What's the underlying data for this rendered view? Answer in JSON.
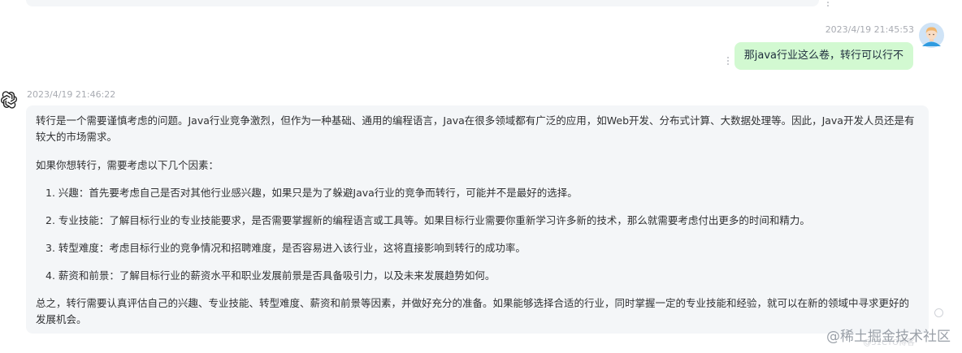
{
  "user_message": {
    "timestamp": "2023/4/19 21:45:53",
    "text": "那java行业这么卷，转行可以行不",
    "avatar_icon": "user-avatar-icon"
  },
  "assistant_message": {
    "timestamp": "2023/4/19 21:46:22",
    "avatar_icon": "openai-logo-icon",
    "intro": "转行是一个需要谨慎考虑的问题。Java行业竞争激烈，但作为一种基础、通用的编程语言，Java在很多领域都有广泛的应用，如Web开发、分布式计算、大数据处理等。因此，Java开发人员还是有较大的市场需求。",
    "lead": "如果你想转行，需要考虑以下几个因素：",
    "items": [
      "1. 兴趣：首先要考虑自己是否对其他行业感兴趣，如果只是为了躲避Java行业的竞争而转行，可能并不是最好的选择。",
      "2. 专业技能：了解目标行业的专业技能要求，是否需要掌握新的编程语言或工具等。如果目标行业需要你重新学习许多新的技术，那么就需要考虑付出更多的时间和精力。",
      "3. 转型难度：考虑目标行业的竞争情况和招聘难度，是否容易进入该行业，这将直接影响到转行的成功率。",
      "4. 薪资和前景：了解目标行业的薪资水平和职业发展前景是否具备吸引力，以及未来发展趋势如何。"
    ],
    "conclusion": "总之，转行需要认真评估自己的兴趣、专业技能、转型难度、薪资和前景等因素，并做好充分的准备。如果能够选择合适的行业，同时掌握一定的专业技能和经验，就可以在新的领域中寻求更好的发展机会。"
  },
  "watermark": {
    "main": "@稀土掘金技术社区",
    "sub": "@51CTO博客"
  },
  "colors": {
    "user_bubble": "#d2f9d1",
    "assistant_bubble": "#f4f6f8",
    "timestamp": "#a8abb2"
  }
}
